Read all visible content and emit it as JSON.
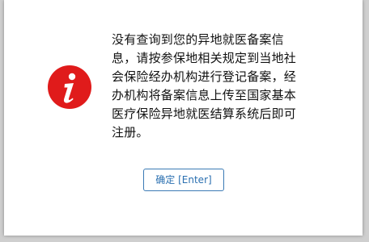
{
  "dialog": {
    "icon": "info-icon",
    "icon_color": "#e02020",
    "message": "没有查询到您的异地就医备案信息，请按参保地相关规定到当地社会保险经办机构进行登记备案，经办机构将备案信息上传至国家基本医疗保险异地就医结算系统后即可注册。",
    "ok_button_label": "确定 [Enter]"
  }
}
